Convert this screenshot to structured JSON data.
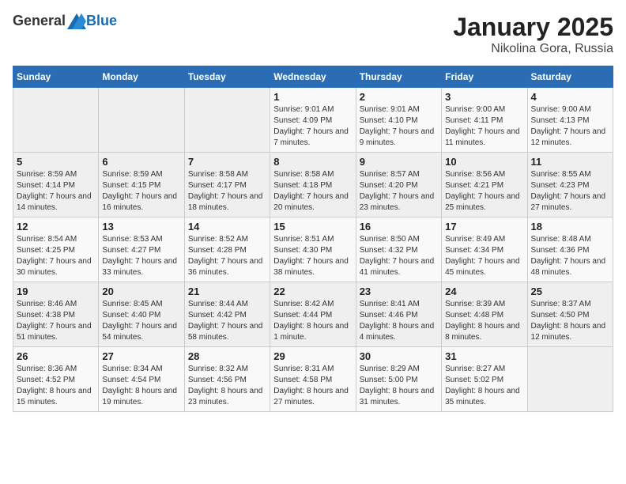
{
  "header": {
    "logo_general": "General",
    "logo_blue": "Blue",
    "title": "January 2025",
    "subtitle": "Nikolina Gora, Russia"
  },
  "weekdays": [
    "Sunday",
    "Monday",
    "Tuesday",
    "Wednesday",
    "Thursday",
    "Friday",
    "Saturday"
  ],
  "weeks": [
    [
      {
        "day": "",
        "info": ""
      },
      {
        "day": "",
        "info": ""
      },
      {
        "day": "",
        "info": ""
      },
      {
        "day": "1",
        "info": "Sunrise: 9:01 AM\nSunset: 4:09 PM\nDaylight: 7 hours and 7 minutes."
      },
      {
        "day": "2",
        "info": "Sunrise: 9:01 AM\nSunset: 4:10 PM\nDaylight: 7 hours and 9 minutes."
      },
      {
        "day": "3",
        "info": "Sunrise: 9:00 AM\nSunset: 4:11 PM\nDaylight: 7 hours and 11 minutes."
      },
      {
        "day": "4",
        "info": "Sunrise: 9:00 AM\nSunset: 4:13 PM\nDaylight: 7 hours and 12 minutes."
      }
    ],
    [
      {
        "day": "5",
        "info": "Sunrise: 8:59 AM\nSunset: 4:14 PM\nDaylight: 7 hours and 14 minutes."
      },
      {
        "day": "6",
        "info": "Sunrise: 8:59 AM\nSunset: 4:15 PM\nDaylight: 7 hours and 16 minutes."
      },
      {
        "day": "7",
        "info": "Sunrise: 8:58 AM\nSunset: 4:17 PM\nDaylight: 7 hours and 18 minutes."
      },
      {
        "day": "8",
        "info": "Sunrise: 8:58 AM\nSunset: 4:18 PM\nDaylight: 7 hours and 20 minutes."
      },
      {
        "day": "9",
        "info": "Sunrise: 8:57 AM\nSunset: 4:20 PM\nDaylight: 7 hours and 23 minutes."
      },
      {
        "day": "10",
        "info": "Sunrise: 8:56 AM\nSunset: 4:21 PM\nDaylight: 7 hours and 25 minutes."
      },
      {
        "day": "11",
        "info": "Sunrise: 8:55 AM\nSunset: 4:23 PM\nDaylight: 7 hours and 27 minutes."
      }
    ],
    [
      {
        "day": "12",
        "info": "Sunrise: 8:54 AM\nSunset: 4:25 PM\nDaylight: 7 hours and 30 minutes."
      },
      {
        "day": "13",
        "info": "Sunrise: 8:53 AM\nSunset: 4:27 PM\nDaylight: 7 hours and 33 minutes."
      },
      {
        "day": "14",
        "info": "Sunrise: 8:52 AM\nSunset: 4:28 PM\nDaylight: 7 hours and 36 minutes."
      },
      {
        "day": "15",
        "info": "Sunrise: 8:51 AM\nSunset: 4:30 PM\nDaylight: 7 hours and 38 minutes."
      },
      {
        "day": "16",
        "info": "Sunrise: 8:50 AM\nSunset: 4:32 PM\nDaylight: 7 hours and 41 minutes."
      },
      {
        "day": "17",
        "info": "Sunrise: 8:49 AM\nSunset: 4:34 PM\nDaylight: 7 hours and 45 minutes."
      },
      {
        "day": "18",
        "info": "Sunrise: 8:48 AM\nSunset: 4:36 PM\nDaylight: 7 hours and 48 minutes."
      }
    ],
    [
      {
        "day": "19",
        "info": "Sunrise: 8:46 AM\nSunset: 4:38 PM\nDaylight: 7 hours and 51 minutes."
      },
      {
        "day": "20",
        "info": "Sunrise: 8:45 AM\nSunset: 4:40 PM\nDaylight: 7 hours and 54 minutes."
      },
      {
        "day": "21",
        "info": "Sunrise: 8:44 AM\nSunset: 4:42 PM\nDaylight: 7 hours and 58 minutes."
      },
      {
        "day": "22",
        "info": "Sunrise: 8:42 AM\nSunset: 4:44 PM\nDaylight: 8 hours and 1 minute."
      },
      {
        "day": "23",
        "info": "Sunrise: 8:41 AM\nSunset: 4:46 PM\nDaylight: 8 hours and 4 minutes."
      },
      {
        "day": "24",
        "info": "Sunrise: 8:39 AM\nSunset: 4:48 PM\nDaylight: 8 hours and 8 minutes."
      },
      {
        "day": "25",
        "info": "Sunrise: 8:37 AM\nSunset: 4:50 PM\nDaylight: 8 hours and 12 minutes."
      }
    ],
    [
      {
        "day": "26",
        "info": "Sunrise: 8:36 AM\nSunset: 4:52 PM\nDaylight: 8 hours and 15 minutes."
      },
      {
        "day": "27",
        "info": "Sunrise: 8:34 AM\nSunset: 4:54 PM\nDaylight: 8 hours and 19 minutes."
      },
      {
        "day": "28",
        "info": "Sunrise: 8:32 AM\nSunset: 4:56 PM\nDaylight: 8 hours and 23 minutes."
      },
      {
        "day": "29",
        "info": "Sunrise: 8:31 AM\nSunset: 4:58 PM\nDaylight: 8 hours and 27 minutes."
      },
      {
        "day": "30",
        "info": "Sunrise: 8:29 AM\nSunset: 5:00 PM\nDaylight: 8 hours and 31 minutes."
      },
      {
        "day": "31",
        "info": "Sunrise: 8:27 AM\nSunset: 5:02 PM\nDaylight: 8 hours and 35 minutes."
      },
      {
        "day": "",
        "info": ""
      }
    ]
  ]
}
